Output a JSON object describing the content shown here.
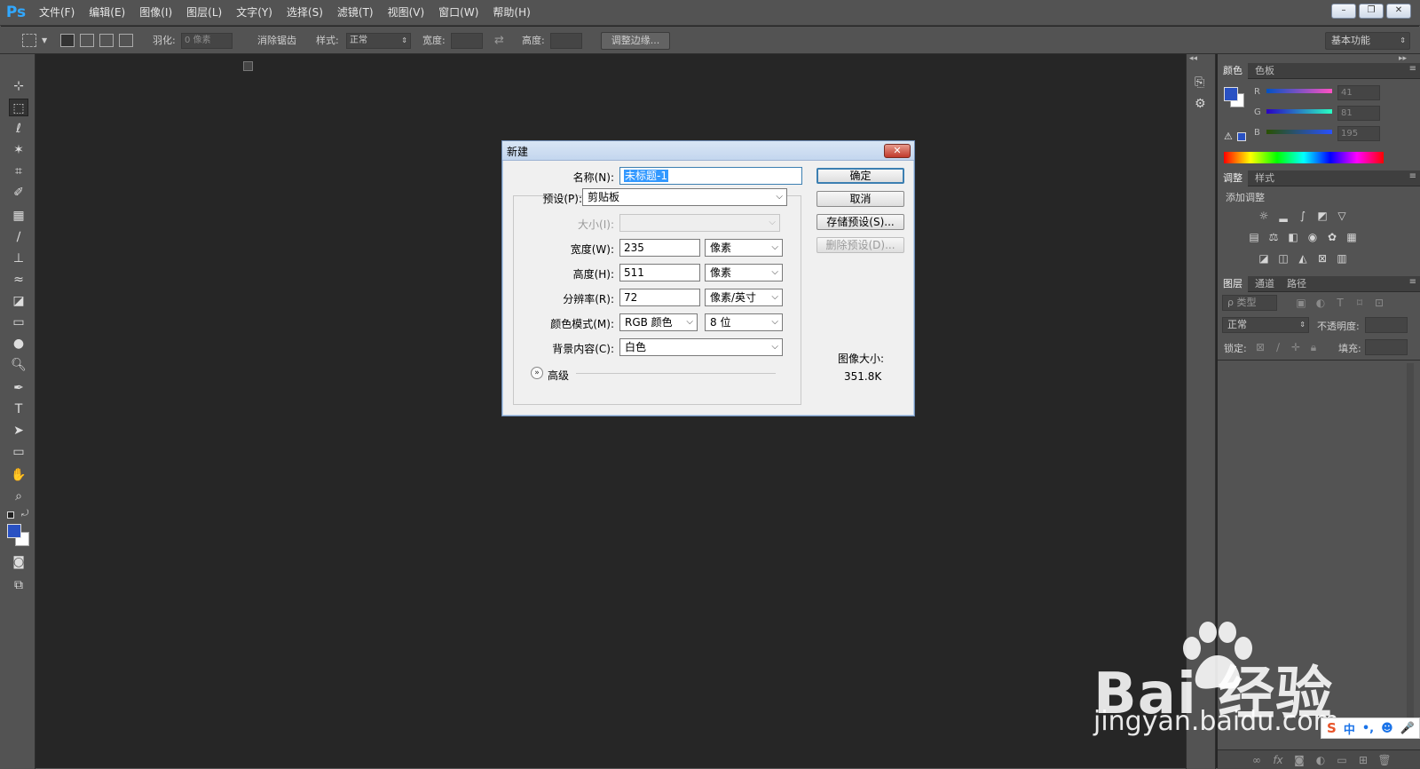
{
  "app": {
    "logo": "Ps"
  },
  "menu": [
    "文件(F)",
    "编辑(E)",
    "图像(I)",
    "图层(L)",
    "文字(Y)",
    "选择(S)",
    "滤镜(T)",
    "视图(V)",
    "窗口(W)",
    "帮助(H)"
  ],
  "window_controls": {
    "minimize": "–",
    "restore": "❐",
    "close": "✕"
  },
  "options_bar": {
    "feather_label": "羽化:",
    "feather_value": "0 像素",
    "antialias_label": "消除锯齿",
    "style_label": "样式:",
    "style_value": "正常",
    "width_label": "宽度:",
    "height_label": "高度:",
    "refine_edge": "调整边缘...",
    "workspace": "基本功能"
  },
  "color_panel": {
    "tabs": [
      "颜色",
      "色板"
    ],
    "channels": [
      {
        "name": "R",
        "value": "41"
      },
      {
        "name": "G",
        "value": "81"
      },
      {
        "name": "B",
        "value": "195"
      }
    ],
    "foreground": "#2951c3",
    "background": "#ffffff"
  },
  "adjust_panel": {
    "tabs": [
      "调整",
      "样式"
    ],
    "subtitle": "添加调整"
  },
  "layers_panel": {
    "tabs": [
      "图层",
      "通道",
      "路径"
    ],
    "filter_label": "ρ 类型",
    "blend_mode": "正常",
    "opacity_label": "不透明度:",
    "lock_label": "锁定:",
    "fill_label": "填充:"
  },
  "dialog": {
    "title": "新建",
    "close": "✕",
    "fields": {
      "name": {
        "label": "名称(N):",
        "value": "未标题-1"
      },
      "preset": {
        "label": "预设(P):",
        "value": "剪贴板"
      },
      "size": {
        "label": "大小(I):",
        "value": ""
      },
      "width": {
        "label": "宽度(W):",
        "value": "235",
        "unit": "像素"
      },
      "height": {
        "label": "高度(H):",
        "value": "511",
        "unit": "像素"
      },
      "resolution": {
        "label": "分辨率(R):",
        "value": "72",
        "unit": "像素/英寸"
      },
      "color_mode": {
        "label": "颜色模式(M):",
        "value": "RGB 颜色",
        "depth": "8 位"
      },
      "background": {
        "label": "背景内容(C):",
        "value": "白色"
      }
    },
    "advanced_label": "高级",
    "buttons": {
      "ok": "确定",
      "cancel": "取消",
      "save_preset": "存储预设(S)...",
      "delete_preset": "删除预设(D)..."
    },
    "image_size_label": "图像大小:",
    "image_size_value": "351.8K"
  },
  "watermark": {
    "brand": "Bai  经验",
    "url": "jingyan.baidu.com"
  },
  "ime": {
    "mode": "中",
    "punct": "•,",
    "emoji": "☻",
    "mic": "🎤"
  }
}
